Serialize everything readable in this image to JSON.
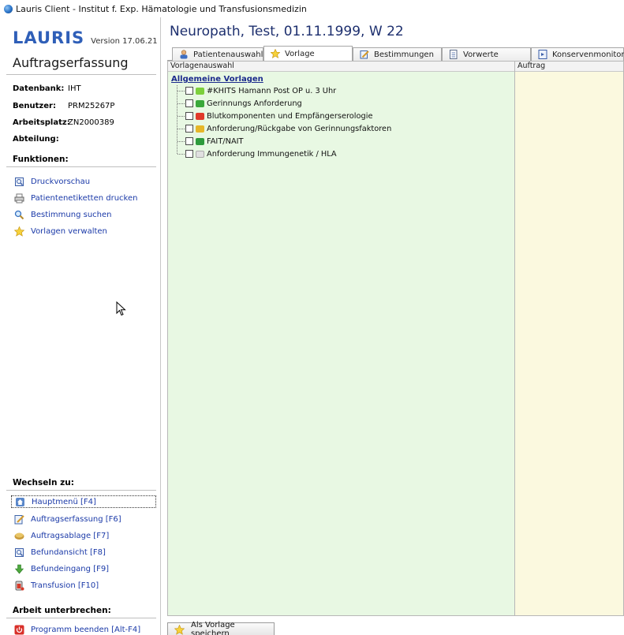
{
  "window": {
    "title": "Lauris Client - Institut f. Exp. Hämatologie und Transfusionsmedizin"
  },
  "sidebar": {
    "logo": "LAURIS",
    "version": "Version 17.06.21",
    "title": "Auftragserfassung",
    "info": [
      {
        "label": "Datenbank:",
        "value": "IHT"
      },
      {
        "label": "Benutzer:",
        "value": "PRM25267P"
      },
      {
        "label": "Arbeitsplatz:",
        "value": "ZN2000389"
      },
      {
        "label": "Abteilung:",
        "value": ""
      }
    ],
    "functions_heading": "Funktionen:",
    "functions": [
      {
        "label": "Druckvorschau",
        "icon": "print-preview-icon"
      },
      {
        "label": "Patientenetiketten drucken",
        "icon": "printer-icon"
      },
      {
        "label": "Bestimmung suchen",
        "icon": "search-icon"
      },
      {
        "label": "Vorlagen verwalten",
        "icon": "star-icon"
      }
    ],
    "switch_heading": "Wechseln zu:",
    "switch_items": [
      {
        "label": "Hauptmenü [F4]",
        "icon": "home-icon"
      },
      {
        "label": "Auftragserfassung [F6]",
        "icon": "edit-order-icon"
      },
      {
        "label": "Auftragsablage [F7]",
        "icon": "order-archive-icon"
      },
      {
        "label": "Befundansicht [F8]",
        "icon": "report-view-icon"
      },
      {
        "label": "Befundeingang [F9]",
        "icon": "report-inbox-icon"
      },
      {
        "label": "Transfusion [F10]",
        "icon": "transfusion-icon"
      }
    ],
    "pause_heading": "Arbeit unterbrechen:",
    "pause_items": [
      {
        "label": "Programm beenden [Alt-F4]",
        "icon": "power-icon"
      }
    ]
  },
  "header": {
    "patient": "Neuropath, Test, 01.11.1999, W 22"
  },
  "tabs": [
    {
      "label": "Patientenauswahl",
      "icon": "patient-icon"
    },
    {
      "label": "Vorlage",
      "icon": "star-icon"
    },
    {
      "label": "Bestimmungen",
      "icon": "edit-icon"
    },
    {
      "label": "Vorwerte",
      "icon": "document-icon"
    },
    {
      "label": "Konservenmonitor",
      "icon": "monitor-icon"
    }
  ],
  "templates": {
    "column_header": "Vorlagenauswahl",
    "group": "Allgemeine Vorlagen",
    "items": [
      {
        "label": "#KHITS Hamann Post OP u. 3 Uhr",
        "color": "#7ccf3c",
        "checked": false
      },
      {
        "label": "Gerinnungs Anforderung",
        "color": "#3aa83a",
        "checked": false
      },
      {
        "label": "Blutkomponenten und Empfängerserologie",
        "color": "#e03a2a",
        "checked": false
      },
      {
        "label": "Anforderung/Rückgabe von Gerinnungsfaktoren",
        "color": "#e6b729",
        "checked": false
      },
      {
        "label": "FAIT/NAIT",
        "color": "#2e9a3c",
        "checked": false
      },
      {
        "label": "Anforderung Immungenetik / HLA",
        "color": "#e0e0e0",
        "checked": false
      }
    ]
  },
  "order": {
    "column_header": "Auftrag"
  },
  "footer": {
    "save_template_label": "Als Vorlage speichern"
  }
}
